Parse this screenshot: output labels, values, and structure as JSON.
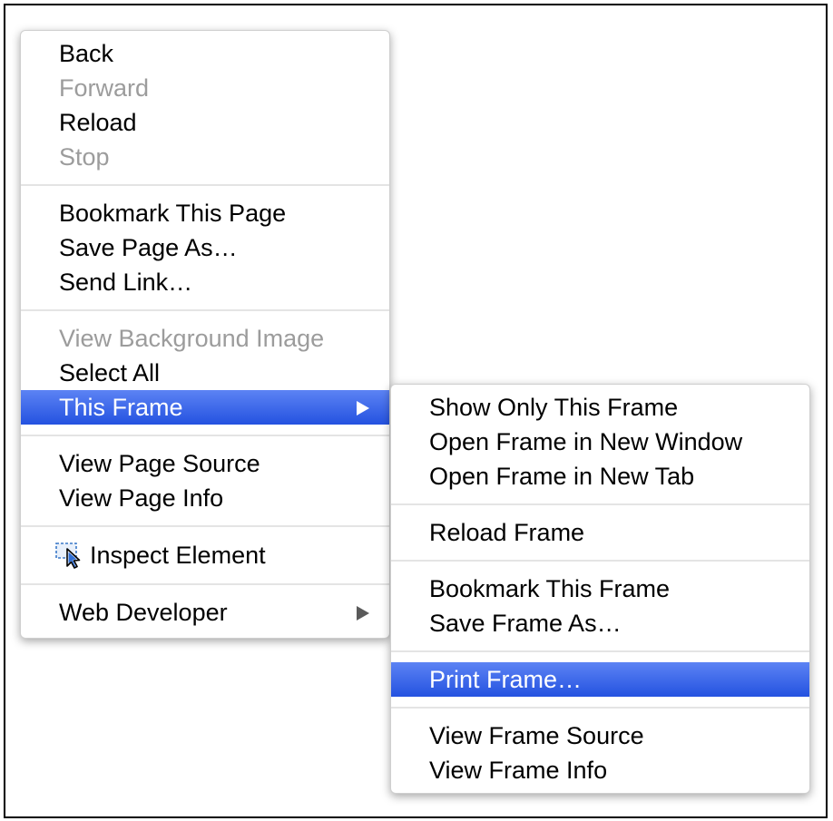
{
  "main_menu": {
    "group1": {
      "back": "Back",
      "forward": "Forward",
      "reload": "Reload",
      "stop": "Stop"
    },
    "group2": {
      "bookmark_page": "Bookmark This Page",
      "save_page_as": "Save Page As…",
      "send_link": "Send Link…"
    },
    "group3": {
      "view_background_image": "View Background Image",
      "select_all": "Select All",
      "this_frame": "This Frame"
    },
    "group4": {
      "view_page_source": "View Page Source",
      "view_page_info": "View Page Info"
    },
    "group5": {
      "inspect_element": "Inspect Element",
      "inspect_icon": "inspect-element-icon"
    },
    "group6": {
      "web_developer": "Web Developer"
    }
  },
  "frame_submenu": {
    "show_only_this_frame": "Show Only This Frame",
    "open_frame_new_window": "Open Frame in New Window",
    "open_frame_new_tab": "Open Frame in New Tab",
    "reload_frame": "Reload Frame",
    "bookmark_frame": "Bookmark This Frame",
    "save_frame_as": "Save Frame As…",
    "print_frame": "Print Frame…",
    "view_frame_source": "View Frame Source",
    "view_frame_info": "View Frame Info"
  },
  "colors": {
    "highlight": "#2f5ee6",
    "disabled_text": "#9c9c9c",
    "separator": "#e4e4e4"
  }
}
